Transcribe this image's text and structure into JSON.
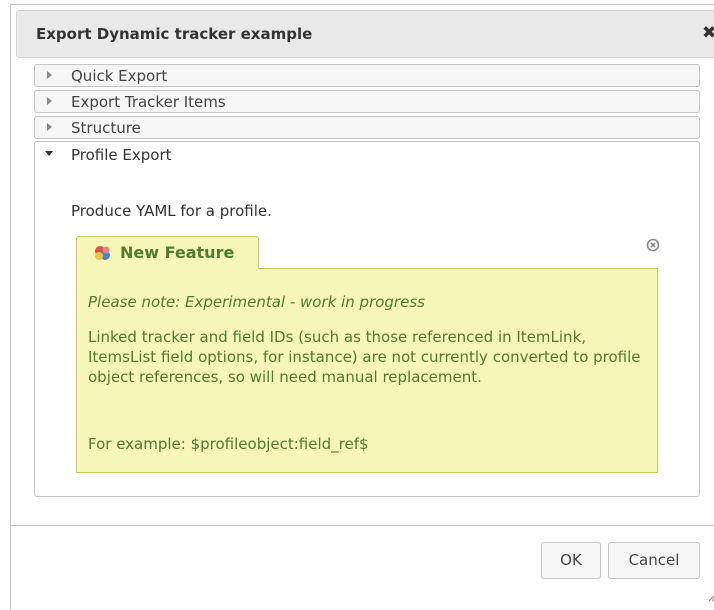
{
  "dialog": {
    "title": "Export Dynamic tracker example",
    "close_glyph": "✖"
  },
  "accordion": {
    "sections": [
      {
        "label": "Quick Export",
        "expanded": false
      },
      {
        "label": "Export Tracker Items",
        "expanded": false
      },
      {
        "label": "Structure",
        "expanded": false
      },
      {
        "label": "Profile Export",
        "expanded": true
      }
    ],
    "profile_export": {
      "description": "Produce YAML for a profile.",
      "notice": {
        "title": "New Feature",
        "icon": "new-feature-icon",
        "note": "Please note: Experimental - work in progress",
        "body": "Linked tracker and field IDs (such as those referenced in ItemLink, ItemsList field options, for instance) are not currently converted to profile object references, so will need manual replacement.",
        "example": "For example: $profileobject:field_ref$"
      }
    }
  },
  "buttons": {
    "ok": "OK",
    "cancel": "Cancel"
  },
  "colors": {
    "titlebar_bg": "#e9e9e9",
    "notice_bg": "#f5f6b8",
    "notice_border": "#c6cc59",
    "notice_text": "#4e7d2b"
  }
}
